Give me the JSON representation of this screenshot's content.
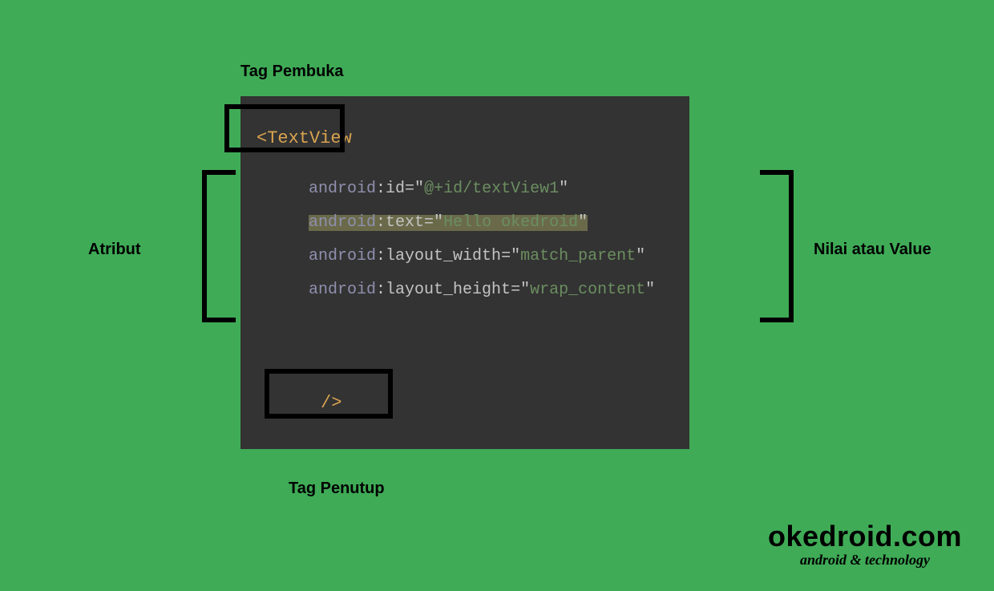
{
  "labels": {
    "tag_open": "Tag Pembuka",
    "attribute": "Atribut",
    "value": "Nilai atau Value",
    "tag_close": "Tag Penutup"
  },
  "code": {
    "open_tag": "<TextView",
    "close_tag": "/>",
    "lines": [
      {
        "ns": "android",
        "attr": "id",
        "value": "@+id/textView1",
        "highlighted": false
      },
      {
        "ns": "android",
        "attr": "text",
        "value": "Hello okedroid",
        "highlighted": true
      },
      {
        "ns": "android",
        "attr": "layout_width",
        "value": "match_parent",
        "highlighted": false
      },
      {
        "ns": "android",
        "attr": "layout_height",
        "value": "wrap_content",
        "highlighted": false
      }
    ]
  },
  "watermark": {
    "brand": "okedroid.com",
    "tagline_before": "android ",
    "tagline_amp": "&",
    "tagline_after": " technology"
  }
}
